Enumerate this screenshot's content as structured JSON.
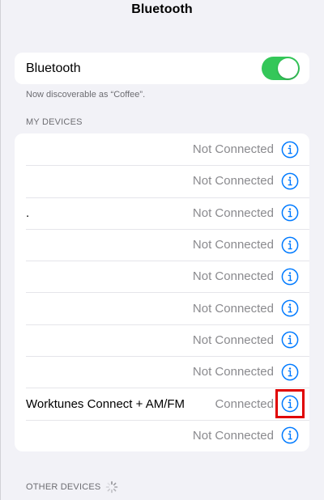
{
  "nav": {
    "title": "Bluetooth"
  },
  "bluetooth": {
    "label": "Bluetooth",
    "enabled": true,
    "toggle_color": "#34c759",
    "footnote": "Now discoverable as “Coffee”."
  },
  "my_devices": {
    "header": "MY DEVICES",
    "rows": [
      {
        "name": "",
        "status": "Not Connected",
        "icon": "info-icon"
      },
      {
        "name": "",
        "status": "Not Connected",
        "icon": "info-icon"
      },
      {
        "name": ".",
        "status": "Not Connected",
        "icon": "info-icon"
      },
      {
        "name": "",
        "status": "Not Connected",
        "icon": "info-icon"
      },
      {
        "name": "",
        "status": "Not Connected",
        "icon": "info-icon"
      },
      {
        "name": "",
        "status": "Not Connected",
        "icon": "info-icon"
      },
      {
        "name": "",
        "status": "Not Connected",
        "icon": "info-icon"
      },
      {
        "name": "",
        "status": "Not Connected",
        "icon": "info-icon"
      },
      {
        "name": "Worktunes Connect + AM/FM",
        "status": "Connected",
        "icon": "info-icon",
        "highlighted": true
      },
      {
        "name": "",
        "status": "Not Connected",
        "icon": "info-icon"
      }
    ]
  },
  "other_devices": {
    "header": "OTHER DEVICES",
    "icon": "loading-spinner-icon"
  },
  "colors": {
    "accent": "#007aff",
    "highlight": "#e00000",
    "background": "#f2f2f7"
  }
}
